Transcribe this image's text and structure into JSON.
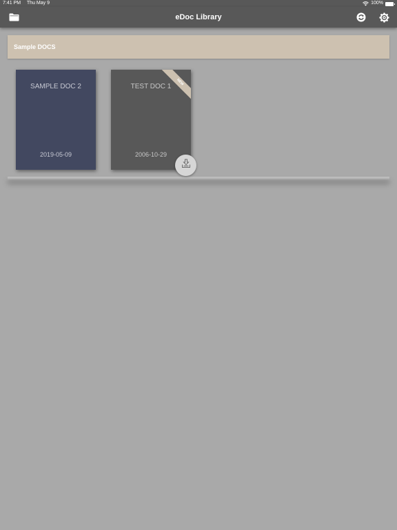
{
  "status_bar": {
    "time": "7:41 PM",
    "date": "Thu May 9",
    "battery": "100%",
    "icons": [
      "wifi-icon",
      "battery-icon"
    ]
  },
  "nav": {
    "title": "eDoc Library",
    "left_icon": "folder-icon",
    "right_icons": [
      "sync-icon",
      "gear-icon"
    ]
  },
  "section": {
    "title": "Sample DOCS"
  },
  "documents": [
    {
      "title": "SAMPLE DOC 2",
      "date": "2019-05-09",
      "cover_color": "#424860",
      "text_color": "#c7c9d3",
      "badge": ""
    },
    {
      "title": "TEST DOC 1",
      "date": "2006-10-29",
      "cover_color": "#585858",
      "text_color": "#c7c7c7",
      "badge": "NEW",
      "action_icon": "download-icon"
    }
  ],
  "colors": {
    "background": "#a9a9a9",
    "nav_bar": "#585858",
    "section_header": "#cdc1b0"
  }
}
